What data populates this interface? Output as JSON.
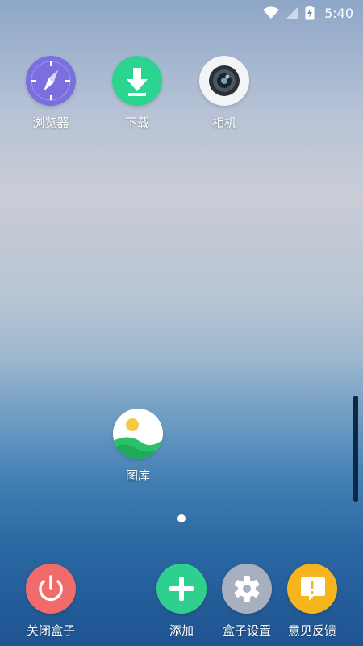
{
  "status_bar": {
    "time": "5:40",
    "icons": [
      "wifi-icon",
      "cellular-signal-icon",
      "battery-charging-icon"
    ]
  },
  "home_apps": [
    {
      "label": "浏览器",
      "icon": "compass-icon",
      "color": "#7b6fe0"
    },
    {
      "label": "下载",
      "icon": "download-arrow-icon",
      "color": "#2bd58f"
    },
    {
      "label": "相机",
      "icon": "camera-lens-icon",
      "color": "#f2f4f6"
    },
    {
      "label": "图库",
      "icon": "landscape-photo-icon",
      "color": "#ffffff"
    }
  ],
  "page_indicator": {
    "current": 1,
    "total": 1
  },
  "dock": [
    {
      "label": "关闭盒子",
      "icon": "power-icon",
      "color": "#f26b6b"
    },
    {
      "label": "添加",
      "icon": "plus-icon",
      "color": "#2fd08d"
    },
    {
      "label": "盒子设置",
      "icon": "gear-icon",
      "color": "#a8b0bf"
    },
    {
      "label": "意见反馈",
      "icon": "exclamation-message-icon",
      "color": "#f6b51c"
    }
  ]
}
